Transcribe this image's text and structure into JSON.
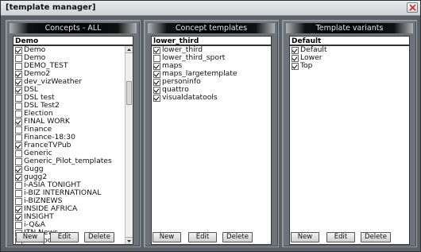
{
  "window": {
    "title": "[template manager]"
  },
  "panels": [
    {
      "header": "Concepts - ALL",
      "selected": "Demo",
      "items": [
        {
          "label": "Demo",
          "checked": true
        },
        {
          "label": "Demo",
          "checked": false
        },
        {
          "label": "DEMO_TEST",
          "checked": false
        },
        {
          "label": "Demo2",
          "checked": true
        },
        {
          "label": "dev_vizWeather",
          "checked": true
        },
        {
          "label": "DSL",
          "checked": true
        },
        {
          "label": "DSL test",
          "checked": false
        },
        {
          "label": "DSL Test2",
          "checked": false
        },
        {
          "label": "Election",
          "checked": false
        },
        {
          "label": "FINAL WORK",
          "checked": true
        },
        {
          "label": "Finance",
          "checked": false
        },
        {
          "label": "Finance-18:30",
          "checked": false
        },
        {
          "label": "FranceTVPub",
          "checked": true
        },
        {
          "label": "Generic",
          "checked": false
        },
        {
          "label": "Generic_Pilot_templates",
          "checked": false
        },
        {
          "label": "Gugg",
          "checked": true
        },
        {
          "label": "gugg2",
          "checked": true
        },
        {
          "label": "i-ASIA TONIGHT",
          "checked": false
        },
        {
          "label": "i-BIZ INTERNATIONAL",
          "checked": false
        },
        {
          "label": "i-BIZNEWS",
          "checked": false
        },
        {
          "label": "INSIDE AFRICA",
          "checked": true
        },
        {
          "label": "INSIGHT",
          "checked": true
        },
        {
          "label": "i-Q&A",
          "checked": false
        },
        {
          "label": "ITN News",
          "checked": false
        },
        {
          "label": "ITN Sports",
          "checked": false
        },
        {
          "label": "LWRT",
          "checked": false
        }
      ],
      "buttons": {
        "new": "New",
        "edit": "Edit",
        "delete": "Delete"
      }
    },
    {
      "header": "Concept templates",
      "selected": "lower_third",
      "items": [
        {
          "label": "lower_third",
          "checked": true
        },
        {
          "label": "lower_third_sport",
          "checked": false
        },
        {
          "label": "maps",
          "checked": true
        },
        {
          "label": "maps_largetemplate",
          "checked": true
        },
        {
          "label": "personinfo",
          "checked": true
        },
        {
          "label": "quattro",
          "checked": true
        },
        {
          "label": "visualdatatools",
          "checked": true
        }
      ],
      "buttons": {
        "new": "New",
        "edit": "Edit",
        "delete": "Delete"
      }
    },
    {
      "header": "Template variants",
      "selected": "Default",
      "items": [
        {
          "label": "Default",
          "checked": true
        },
        {
          "label": "Lower",
          "checked": true
        },
        {
          "label": "Top",
          "checked": true
        }
      ],
      "buttons": {
        "new": "New",
        "edit": "Edit",
        "delete": "Delete"
      }
    }
  ]
}
